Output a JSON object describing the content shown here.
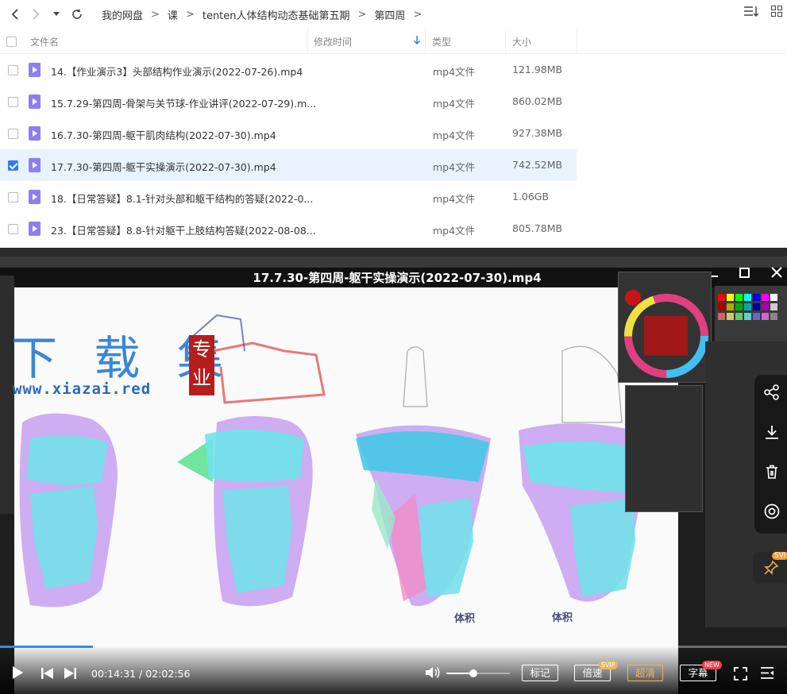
{
  "breadcrumb": [
    "我的网盘",
    "课",
    "tenten人体结构动态基础第五期",
    "第四周"
  ],
  "columns": {
    "name": "文件名",
    "modified": "修改时间",
    "type": "类型",
    "size": "大小"
  },
  "files": [
    {
      "name": "14.【作业演示3】头部结构作业演示(2022-07-26).mp4",
      "type": "mp4文件",
      "size": "121.98MB",
      "checked": false
    },
    {
      "name": "15.7.29-第四周-骨架与关节球-作业讲评(2022-07-29).m...",
      "type": "mp4文件",
      "size": "860.02MB",
      "checked": false
    },
    {
      "name": "16.7.30-第四周-躯干肌肉结构(2022-07-30).mp4",
      "type": "mp4文件",
      "size": "927.38MB",
      "checked": false
    },
    {
      "name": "17.7.30-第四周-躯干实操演示(2022-07-30).mp4",
      "type": "mp4文件",
      "size": "742.52MB",
      "checked": true
    },
    {
      "name": "18.【日常答疑】8.1-针对头部和躯干结构的答疑(2022-0...",
      "type": "mp4文件",
      "size": "1.06GB",
      "checked": false
    },
    {
      "name": "23.【日常答疑】8.8-针对躯干上肢结构答疑(2022-08-08...",
      "type": "mp4文件",
      "size": "805.78MB",
      "checked": false
    }
  ],
  "player": {
    "title": "17.7.30-第四周-躯干实操演示(2022-07-30).mp4",
    "current_time": "00:14:31",
    "total_time": "02:02:56",
    "time_display": "00:14:31 / 02:02:56",
    "progress": 0.118,
    "volume": 0.42,
    "btn_bookmark": "标记",
    "btn_speed": "倍速",
    "btn_quality": "超清",
    "btn_subtitle": "字幕",
    "badge_svip": "SVIP",
    "badge_new": "NEW",
    "side_badge": "SVI"
  },
  "video_content": {
    "watermark_main": "下 载 集",
    "watermark_badge": "专业",
    "watermark_url": "www.xiazai.red",
    "label_volume_1": "体积",
    "label_volume_2": "体积"
  },
  "colors": {
    "accent": "#2e7cf6",
    "selected_row": "#e8f3fd",
    "file_icon": "#8c7ff0",
    "player_bg": "#1e1e1e",
    "gold": "#f0b45a"
  }
}
